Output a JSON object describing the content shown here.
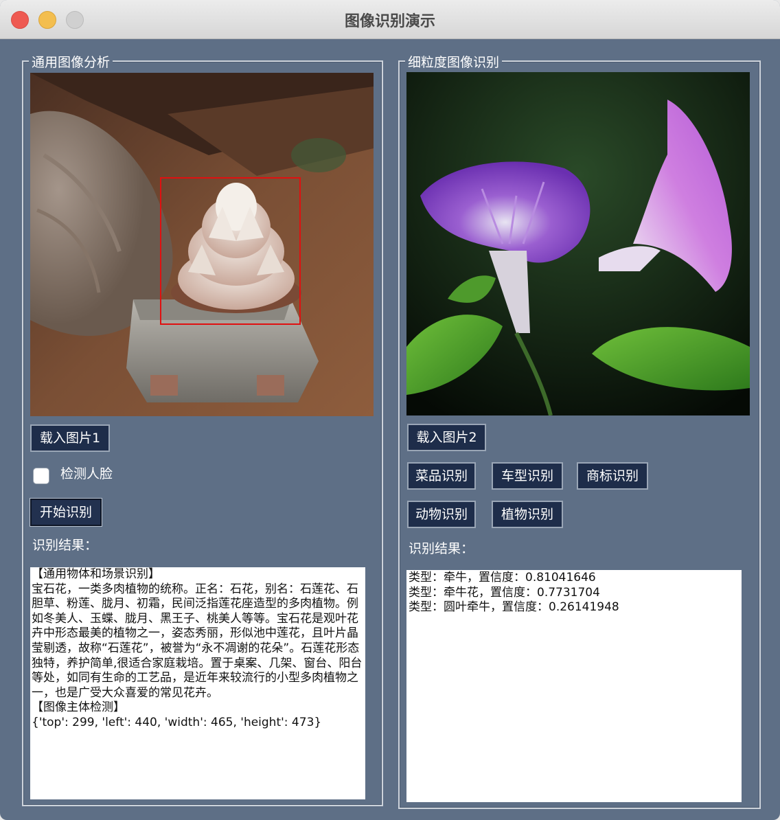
{
  "window": {
    "title": "图像识别演示"
  },
  "left_panel": {
    "title": "通用图像分析",
    "load_button": "载入图片1",
    "face_checkbox_label": "检测人脸",
    "face_checkbox_checked": false,
    "start_button": "开始识别",
    "result_label": "识别结果：",
    "result_text": "【通用物体和场景识别】\n宝石花，一类多肉植物的统称。正名：石花，别名：石莲花、石胆草、粉莲、胧月、初霜，民间泛指莲花座造型的多肉植物。例如冬美人、玉蝶、胧月、黑王子、桃美人等等。宝石花是观叶花卉中形态最美的植物之一，姿态秀丽，形似池中莲花，且叶片晶莹剔透，故称“石莲花”，被誉为“永不凋谢的花朵”。石莲花形态独特，养护简单,很适合家庭栽培。置于桌案、几架、窗台、阳台等处，如同有生命的工艺品，是近年来较流行的小型多肉植物之一，也是广受大众喜爱的常见花卉。\n【图像主体检测】\n{'top': 299, 'left': 440, 'width': 465, 'height': 473}"
  },
  "right_panel": {
    "title": "细粒度图像识别",
    "load_button": "载入图片2",
    "buttons": [
      "菜品识别",
      "车型识别",
      "商标识别",
      "动物识别",
      "植物识别"
    ],
    "result_label": "识别结果：",
    "result_text": "类型：牵牛，置信度：0.81041646\n类型：牵牛花，置信度：0.7731704\n类型：圆叶牵牛，置信度：0.26141948"
  },
  "colors": {
    "window_bg": "#5e6f86",
    "button_bg": "#1e2d4a",
    "detection_box": "#e01010"
  }
}
